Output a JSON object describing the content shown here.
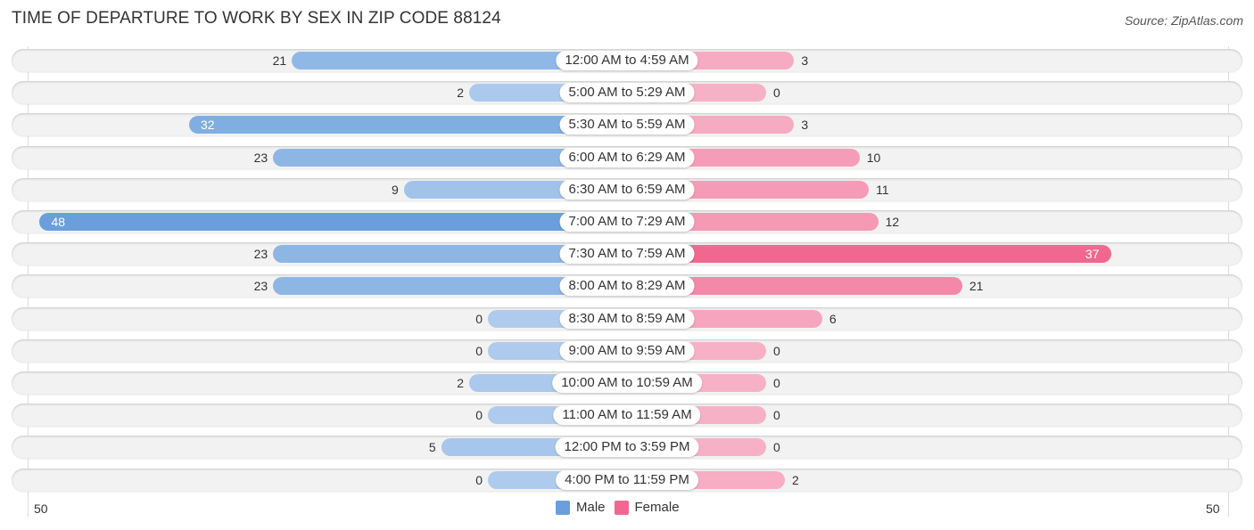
{
  "chart_data": {
    "type": "bar",
    "orientation": "horizontal-diverging",
    "title": "TIME OF DEPARTURE TO WORK BY SEX IN ZIP CODE 88124",
    "source": "Source: ZipAtlas.com",
    "categories": [
      "12:00 AM to 4:59 AM",
      "5:00 AM to 5:29 AM",
      "5:30 AM to 5:59 AM",
      "6:00 AM to 6:29 AM",
      "6:30 AM to 6:59 AM",
      "7:00 AM to 7:29 AM",
      "7:30 AM to 7:59 AM",
      "8:00 AM to 8:29 AM",
      "8:30 AM to 8:59 AM",
      "9:00 AM to 9:59 AM",
      "10:00 AM to 10:59 AM",
      "11:00 AM to 11:59 AM",
      "12:00 PM to 3:59 PM",
      "4:00 PM to 11:59 PM"
    ],
    "series": [
      {
        "name": "Male",
        "color": "#6a9fdc",
        "values": [
          21,
          2,
          32,
          23,
          9,
          48,
          23,
          23,
          0,
          0,
          2,
          0,
          5,
          0
        ]
      },
      {
        "name": "Female",
        "color": "#f06890",
        "values": [
          3,
          0,
          3,
          10,
          11,
          12,
          37,
          21,
          6,
          0,
          0,
          0,
          0,
          2
        ]
      }
    ],
    "axis": {
      "left_label": "50",
      "right_label": "50",
      "range": [
        0,
        50
      ]
    },
    "legend": {
      "placement": "bottom-center",
      "items": [
        "Male",
        "Female"
      ]
    }
  }
}
